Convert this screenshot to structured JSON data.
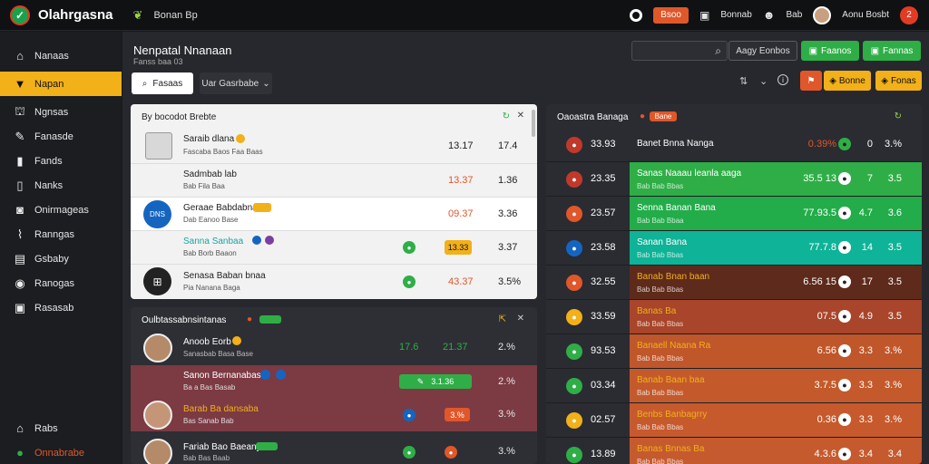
{
  "app": {
    "name": "Olahrgasna",
    "tag": "Bonan Bp",
    "notifications": "2",
    "top_button": "Bsoo",
    "items": [
      "Bonnab",
      "Bab",
      "Aonu Bosbt"
    ]
  },
  "sidebar": {
    "items": [
      {
        "label": "Nanaas",
        "icon": "home-icon"
      },
      {
        "label": "Napan",
        "icon": "inbox-icon"
      },
      {
        "label": "Ngnsas",
        "icon": "bank-icon"
      },
      {
        "label": "Fanasde",
        "icon": "wrench-icon"
      },
      {
        "label": "Fands",
        "icon": "book-icon"
      },
      {
        "label": "Nanks",
        "icon": "books-icon"
      },
      {
        "label": "Onirmageas",
        "icon": "camera-icon"
      },
      {
        "label": "Ranngas",
        "icon": "chart-icon"
      },
      {
        "label": "Gsbaby",
        "icon": "folder-icon"
      },
      {
        "label": "Ranogas",
        "icon": "settings-icon"
      },
      {
        "label": "Rasasab",
        "icon": "export-icon"
      }
    ],
    "bottom": [
      {
        "label": "Rabs",
        "icon": "home-icon"
      },
      {
        "label": "Onnabrabe",
        "icon": "status-icon"
      }
    ]
  },
  "header": {
    "title": "Nenpatal Nnanaan",
    "subtitle": "Fanss baa 03",
    "search_placeholder": "",
    "filter_label": "Aagy Eonbos",
    "green_btn1": "Faanos",
    "green_btn2": "Fannas",
    "orange_btn1": "Bonne",
    "orange_btn2": "Fonas",
    "tabs": [
      "Fasaas",
      "Uar Gasrbabe"
    ]
  },
  "panel_top": {
    "title": "By bocodot Brebte",
    "rows": [
      {
        "name": "Saraib dlana",
        "sub": "Fascaba Baos Faa Baas",
        "v1": "13.17",
        "v2": "17.4"
      },
      {
        "name": "Sadmbab lab",
        "sub": "Bab Fila Baa",
        "v1": "13.37",
        "v2": "1.36"
      },
      {
        "name": "Geraae Babdabna",
        "sub": "Dab Eanoo Base",
        "v1": "09.37",
        "v2": "3.36"
      },
      {
        "name": "Sanna Sanbaa",
        "sub": "Bab Borb Baaon",
        "v1": "13.33",
        "v2": "3.37"
      },
      {
        "name": "Senasa Baban bnaa",
        "sub": "Pia Nanana Baga",
        "v1": "43.37",
        "v2": "3.5%"
      }
    ]
  },
  "panel_bottom": {
    "title": "Oulbtassabnsintanas",
    "rows": [
      {
        "name": "Anoob Eorb",
        "sub": "Sanasbab Basa Base",
        "v1": "17.6",
        "v2": "21.37",
        "v3": "2.%"
      },
      {
        "name": "Sanon Bernanabas",
        "sub": "Ba a Bas Basab",
        "pill": "3.1.36",
        "v3": "2.%"
      },
      {
        "name": "Barab Ba dansaba",
        "sub": "Bas Sanab Bab",
        "v2": "3.%",
        "v3": "3.%"
      },
      {
        "name": "Fariab Bao Baeany",
        "sub": "Bab Bas Baab",
        "v3": "3.%"
      }
    ]
  },
  "panel_right": {
    "title": "Oaoastra Banaga",
    "badge": "Bane",
    "rows": [
      {
        "rank": "33.93",
        "name": "Banet Bnna Nanga",
        "v1": "0.39%",
        "v2": "0",
        "v3": "3.%",
        "color": "#2a2c31"
      },
      {
        "rank": "23.35",
        "name": "Sanas Naaau leanla aaga",
        "sub": "Bab Bab Bbas",
        "v1": "35.5 13",
        "v2": "7",
        "v3": "3.5",
        "color": "#2fae47"
      },
      {
        "rank": "23.57",
        "name": "Senna Banan Bana",
        "sub": "Bab Bab Bbaa",
        "v1": "77.93.5",
        "v2": "4.7",
        "v3": "3.6",
        "color": "#23ac4a"
      },
      {
        "rank": "23.58",
        "name": "Sanan Bana",
        "sub": "Bab Bab Bbas",
        "v1": "77.7.8",
        "v2": "14",
        "v3": "3.5",
        "color": "#0fb397"
      },
      {
        "rank": "32.55",
        "name": "Banab Bnan baan",
        "sub": "Bab Bab Bbas",
        "v1": "6.56 15",
        "v2": "17",
        "v3": "3.5",
        "color": "#5e2a1b"
      },
      {
        "rank": "33.59",
        "name": "Banas Ba",
        "sub": "Bab Bab Bbas",
        "v1": "07.5",
        "v2": "4.9",
        "v3": "3.5",
        "color": "#a8452a"
      },
      {
        "rank": "93.53",
        "name": "Banaell Naana Ra",
        "sub": "Bab Bab Bbas",
        "v1": "6.56",
        "v2": "3.3",
        "v3": "3.%",
        "color": "#c0572a"
      },
      {
        "rank": "03.34",
        "name": "Banab Baan baa",
        "sub": "Bab Bab Bbas",
        "v1": "3.7.5",
        "v2": "3.3",
        "v3": "3.%",
        "color": "#c45a2c"
      },
      {
        "rank": "02.57",
        "name": "Benbs Banbagrry",
        "sub": "Bab Bab Bbas",
        "v1": "0.36",
        "v2": "3.3",
        "v3": "3.%",
        "color": "#c65a2d"
      },
      {
        "rank": "13.89",
        "name": "Banas Bnnas Ba",
        "sub": "Bab Bab Bbas",
        "v1": "4.3.6",
        "v2": "3.4",
        "v3": "3.4",
        "color": "#c55a2e"
      }
    ]
  }
}
